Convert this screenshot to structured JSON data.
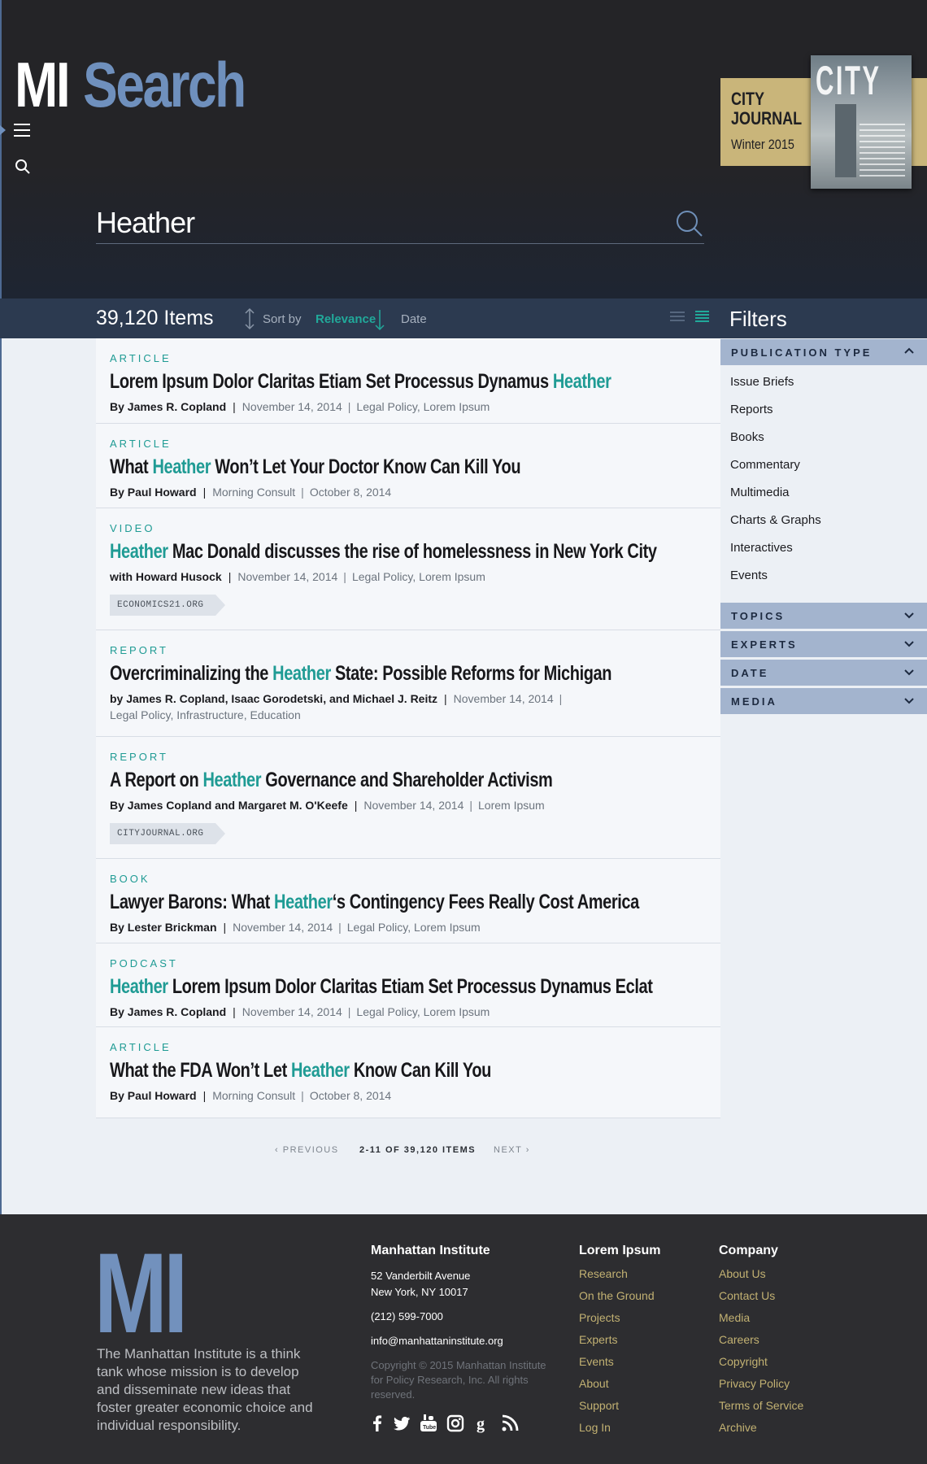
{
  "header": {
    "logo_mi": "MI",
    "logo_search": "Search",
    "promo": {
      "title_line1": "CITY",
      "title_line2": "JOURNAL",
      "issue": "Winter 2015",
      "cover_masthead": "CITY"
    }
  },
  "search": {
    "value": "Heather",
    "placeholder": ""
  },
  "toolbar": {
    "item_count": "39,120 Items",
    "sort_label": "Sort by",
    "sort_relevance": "Relevance",
    "sort_date": "Date"
  },
  "filters": {
    "title": "Filters",
    "publication_type": {
      "label": "PUBLICATION TYPE",
      "items": [
        "Issue Briefs",
        "Reports",
        "Books",
        "Commentary",
        "Multimedia",
        "Charts & Graphs",
        "Interactives",
        "Events"
      ]
    },
    "topics": "TOPICS",
    "experts": "EXPERTS",
    "date": "DATE",
    "media": "MEDIA"
  },
  "results": [
    {
      "type": "ARTICLE",
      "title_pre": "Lorem Ipsum Dolor Claritas Etiam Set Processus Dynamus ",
      "title_hl": "Heather",
      "title_post": "",
      "author": "By James R. Copland",
      "meta": [
        "November 14, 2014",
        "Legal Policy, Lorem Ipsum"
      ],
      "source": ""
    },
    {
      "type": "ARTICLE",
      "title_pre": "What ",
      "title_hl": "Heather",
      "title_post": " Won’t Let Your Doctor Know Can Kill You",
      "author": "By Paul Howard",
      "meta": [
        "Morning Consult",
        "October 8, 2014"
      ],
      "source": ""
    },
    {
      "type": "VIDEO",
      "title_pre": "",
      "title_hl": "Heather",
      "title_post": " Mac Donald discusses the rise of homelessness in New York City",
      "author": "with Howard Husock",
      "meta": [
        "November 14, 2014",
        "Legal Policy, Lorem Ipsum"
      ],
      "source": "ECONOMICS21.ORG"
    },
    {
      "type": "REPORT",
      "title_pre": "Overcriminalizing the ",
      "title_hl": "Heather",
      "title_post": " State: Possible Reforms for Michigan",
      "author": "by James R. Copland, Isaac Gorodetski, and Michael J. Reitz",
      "meta": [
        "November 14, 2014",
        "Legal Policy, Infrastructure, Education"
      ],
      "source": ""
    },
    {
      "type": "REPORT",
      "title_pre": "A Report on ",
      "title_hl": "Heather",
      "title_post": " Governance and Shareholder Activism",
      "author": "By James Copland and Margaret M. O'Keefe",
      "meta": [
        "November 14, 2014",
        "Lorem Ipsum"
      ],
      "source": "CITYJOURNAL.ORG"
    },
    {
      "type": "BOOK",
      "title_pre": "Lawyer Barons: What ",
      "title_hl": "Heather",
      "title_post": "‘s Contingency Fees Really Cost America",
      "author": "By Lester Brickman",
      "meta": [
        "November 14, 2014",
        "Legal Policy, Lorem Ipsum"
      ],
      "source": ""
    },
    {
      "type": "PODCAST",
      "title_pre": "",
      "title_hl": "Heather",
      "title_post": " Lorem Ipsum Dolor Claritas Etiam Set Processus Dynamus Eclat",
      "author": "By James R. Copland",
      "meta": [
        "November 14, 2014",
        "Legal Policy, Lorem Ipsum"
      ],
      "source": ""
    },
    {
      "type": "ARTICLE",
      "title_pre": "What the FDA Won’t Let ",
      "title_hl": "Heather",
      "title_post": " Know Can Kill You",
      "author": "By Paul Howard",
      "meta": [
        "Morning Consult",
        "October 8, 2014"
      ],
      "source": ""
    }
  ],
  "pagination": {
    "previous": "PREVIOUS",
    "info": "2-11 OF 39,120 ITEMS",
    "next": "NEXT"
  },
  "footer": {
    "logo": "MI",
    "tagline": "The Manhattan Institute is a think tank whose mission is to develop and disseminate new ideas that foster greater economic choice and individual responsibility.",
    "institute": {
      "heading": "Manhattan Institute",
      "address1": "52 Vanderbilt Avenue",
      "address2": "New York, NY 10017",
      "phone": "(212) 599-7000",
      "email": "info@manhattaninstitute.org",
      "copyright": "Copyright © 2015 Manhattan Institute for Policy Research, Inc. All rights reserved."
    },
    "lorem": {
      "heading": "Lorem Ipsum",
      "links": [
        "Research",
        "On the Ground",
        "Projects",
        "Experts",
        "Events",
        "About",
        "Support",
        "Log In"
      ]
    },
    "company": {
      "heading": "Company",
      "links": [
        "About Us",
        "Contact Us",
        "Media",
        "Careers",
        "Copyright",
        "Privacy Policy",
        "Terms of Service",
        "Archive"
      ]
    },
    "social": [
      "facebook-icon",
      "twitter-icon",
      "youtube-icon",
      "instagram-icon",
      "google-plus-icon",
      "rss-icon"
    ]
  },
  "colors": {
    "accent_teal": "#1f9b94",
    "brand_blue": "#6f90bd",
    "footer_gold": "#c2b172",
    "header_dark": "#242427"
  }
}
